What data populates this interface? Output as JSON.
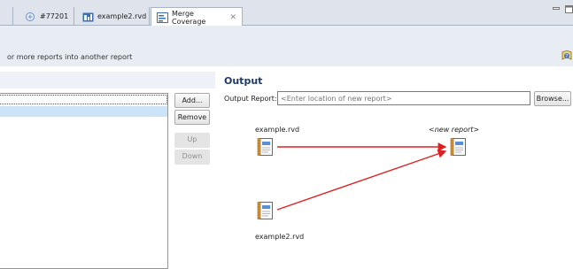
{
  "tabs": [
    {
      "label": "#77201",
      "icon": "task-icon",
      "active": false
    },
    {
      "label": "example2.rvd",
      "icon": "rvd-file-icon",
      "active": false
    },
    {
      "label": "Merge Coverage",
      "icon": "merge-coverage-icon",
      "active": true,
      "close": "✕"
    }
  ],
  "header": {
    "description": "or more reports into another report",
    "help_icon": "help-icon"
  },
  "left_panel": {
    "list_items": [
      ""
    ],
    "buttons": {
      "add": "Add...",
      "remove": "Remove",
      "up": "Up",
      "down": "Down"
    }
  },
  "output": {
    "title": "Output",
    "report_label": "Output Report:",
    "report_placeholder": "<Enter location of new report>",
    "browse": "Browse..."
  },
  "diagram": {
    "sources": [
      "example.rvd",
      "example2.rvd"
    ],
    "target": "<new report>",
    "arrow_color": "#e02020"
  }
}
